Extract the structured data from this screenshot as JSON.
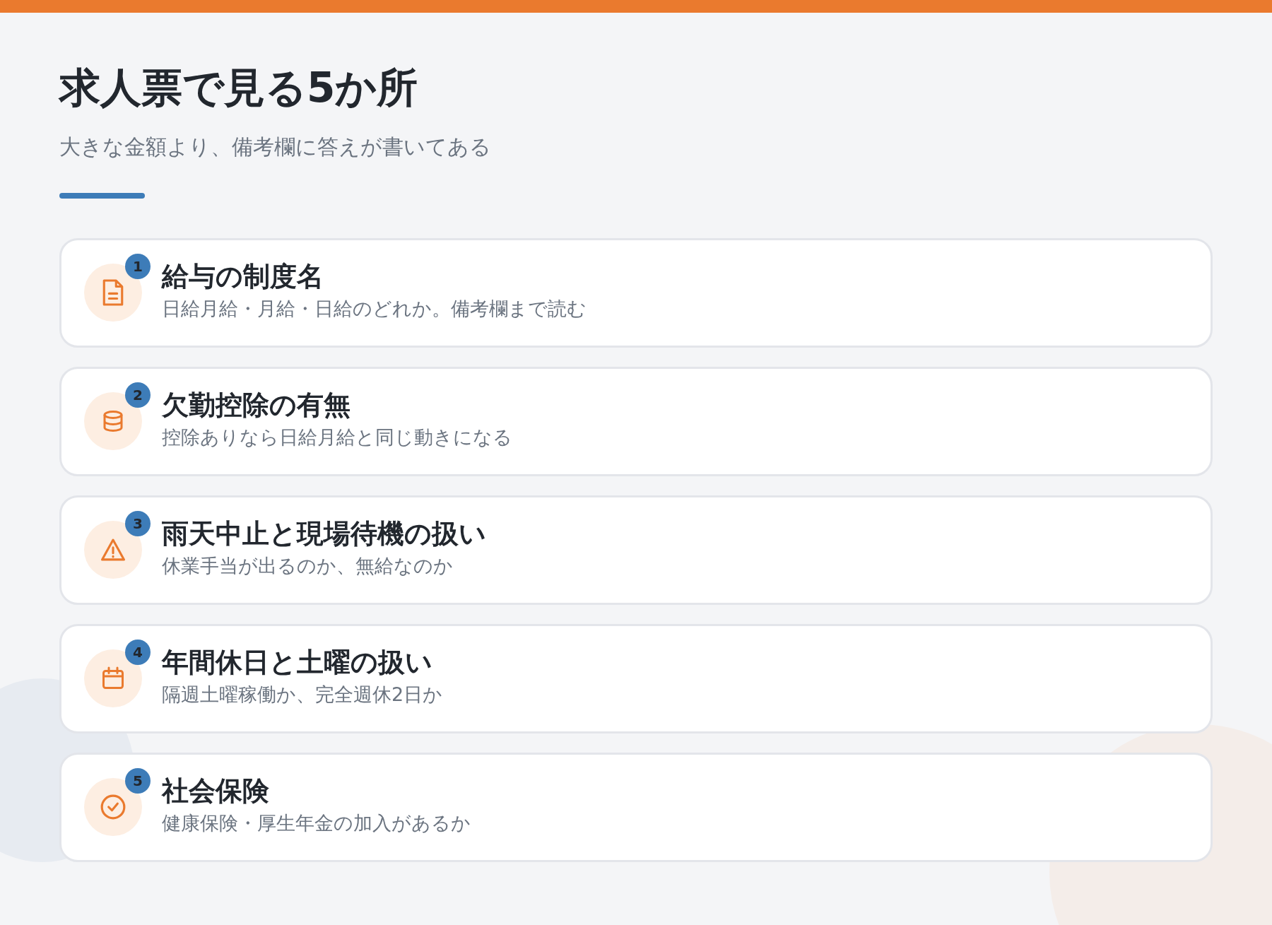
{
  "title": "求人票で見る5か所",
  "subtitle": "大きな金額より、備考欄に答えが書いてある",
  "items": [
    {
      "number": "1",
      "kind": "document",
      "heading": "給与の制度名",
      "description": "日給月給・月給・日給のどれか。備考欄まで読む"
    },
    {
      "number": "2",
      "kind": "coins",
      "heading": "欠勤控除の有無",
      "description": "控除ありなら日給月給と同じ動きになる"
    },
    {
      "number": "3",
      "kind": "warning",
      "heading": "雨天中止と現場待機の扱い",
      "description": "休業手当が出るのか、無給なのか"
    },
    {
      "number": "4",
      "kind": "calendar",
      "heading": "年間休日と土曜の扱い",
      "description": "隔週土曜稼働か、完全週休2日か"
    },
    {
      "number": "5",
      "kind": "check",
      "heading": "社会保険",
      "description": "健康保険・厚生年金の加入があるか"
    }
  ]
}
